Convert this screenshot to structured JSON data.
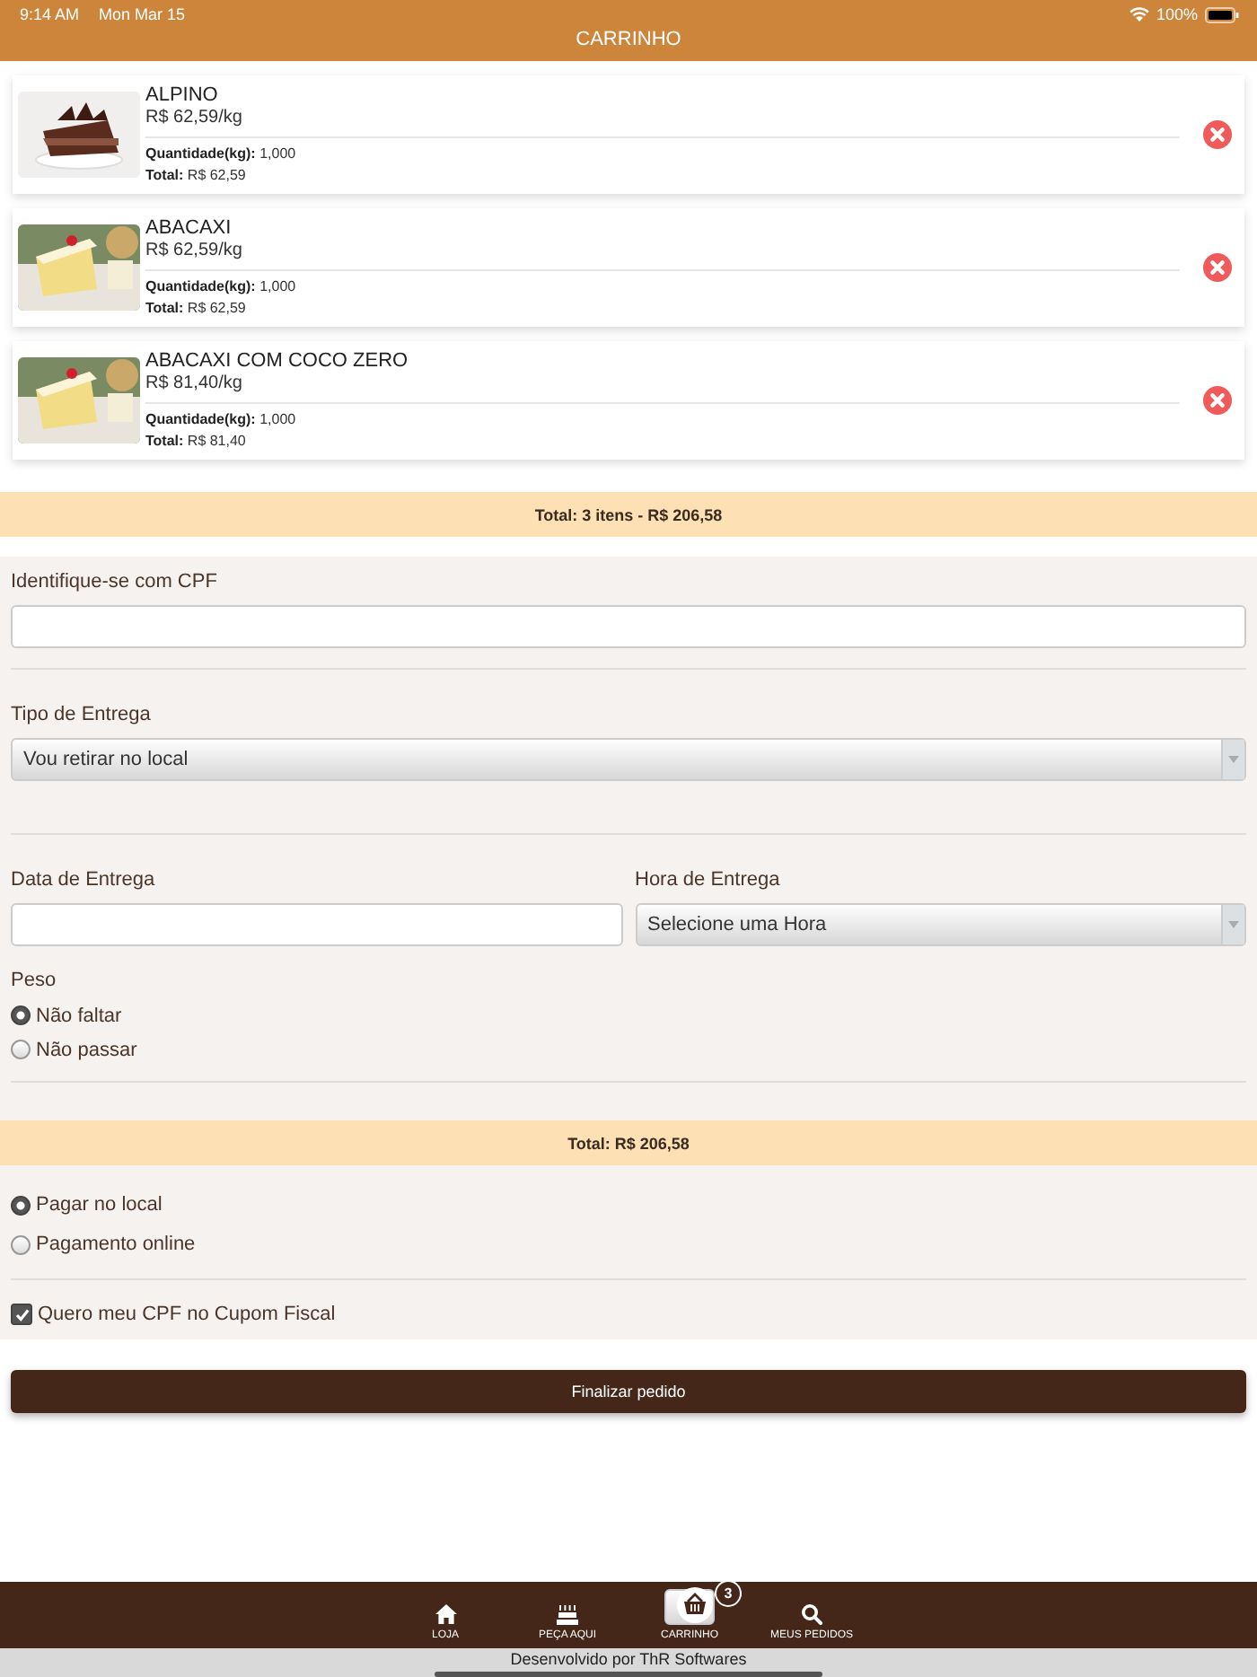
{
  "status_bar": {
    "time": "9:14 AM",
    "date": "Mon Mar 15",
    "battery": "100%"
  },
  "header": {
    "title": "CARRINHO"
  },
  "cart_items": [
    {
      "name": "ALPINO",
      "price": "R$ 62,59/kg",
      "quantity_label": "Quantidade(kg):",
      "quantity": "1,000",
      "total_label": "Total:",
      "total": "R$ 62,59"
    },
    {
      "name": "ABACAXI",
      "price": "R$ 62,59/kg",
      "quantity_label": "Quantidade(kg):",
      "quantity": "1,000",
      "total_label": "Total:",
      "total": "R$ 62,59"
    },
    {
      "name": "ABACAXI COM COCO ZERO",
      "price": "R$ 81,40/kg",
      "quantity_label": "Quantidade(kg):",
      "quantity": "1,000",
      "total_label": "Total:",
      "total": "R$ 81,40"
    }
  ],
  "cart_summary": "Total: 3 itens - R$ 206,58",
  "cpf": {
    "label": "Identifique-se com CPF"
  },
  "delivery_type": {
    "label": "Tipo de Entrega",
    "value": "Vou retirar no local"
  },
  "delivery_date": {
    "label": "Data de Entrega"
  },
  "delivery_time": {
    "label": "Hora de Entrega",
    "value": "Selecione uma Hora"
  },
  "weight": {
    "label": "Peso",
    "options": [
      {
        "label": "Não faltar",
        "selected": true
      },
      {
        "label": "Não passar",
        "selected": false
      }
    ]
  },
  "order_total": "Total: R$ 206,58",
  "payment": {
    "options": [
      {
        "label": "Pagar no local",
        "selected": true
      },
      {
        "label": "Pagamento online",
        "selected": false
      }
    ]
  },
  "cpf_receipt": {
    "label": "Quero meu CPF no Cupom Fiscal",
    "checked": true
  },
  "submit_button": "Finalizar pedido",
  "tab_bar": [
    {
      "label": "LOJA",
      "selected": false
    },
    {
      "label": "PEÇA AQUI",
      "selected": false
    },
    {
      "label": "CARRINHO",
      "selected": true,
      "badge": "3"
    },
    {
      "label": "MEUS PEDIDOS",
      "selected": false
    }
  ],
  "footer": "Desenvolvido por ThR Softwares"
}
